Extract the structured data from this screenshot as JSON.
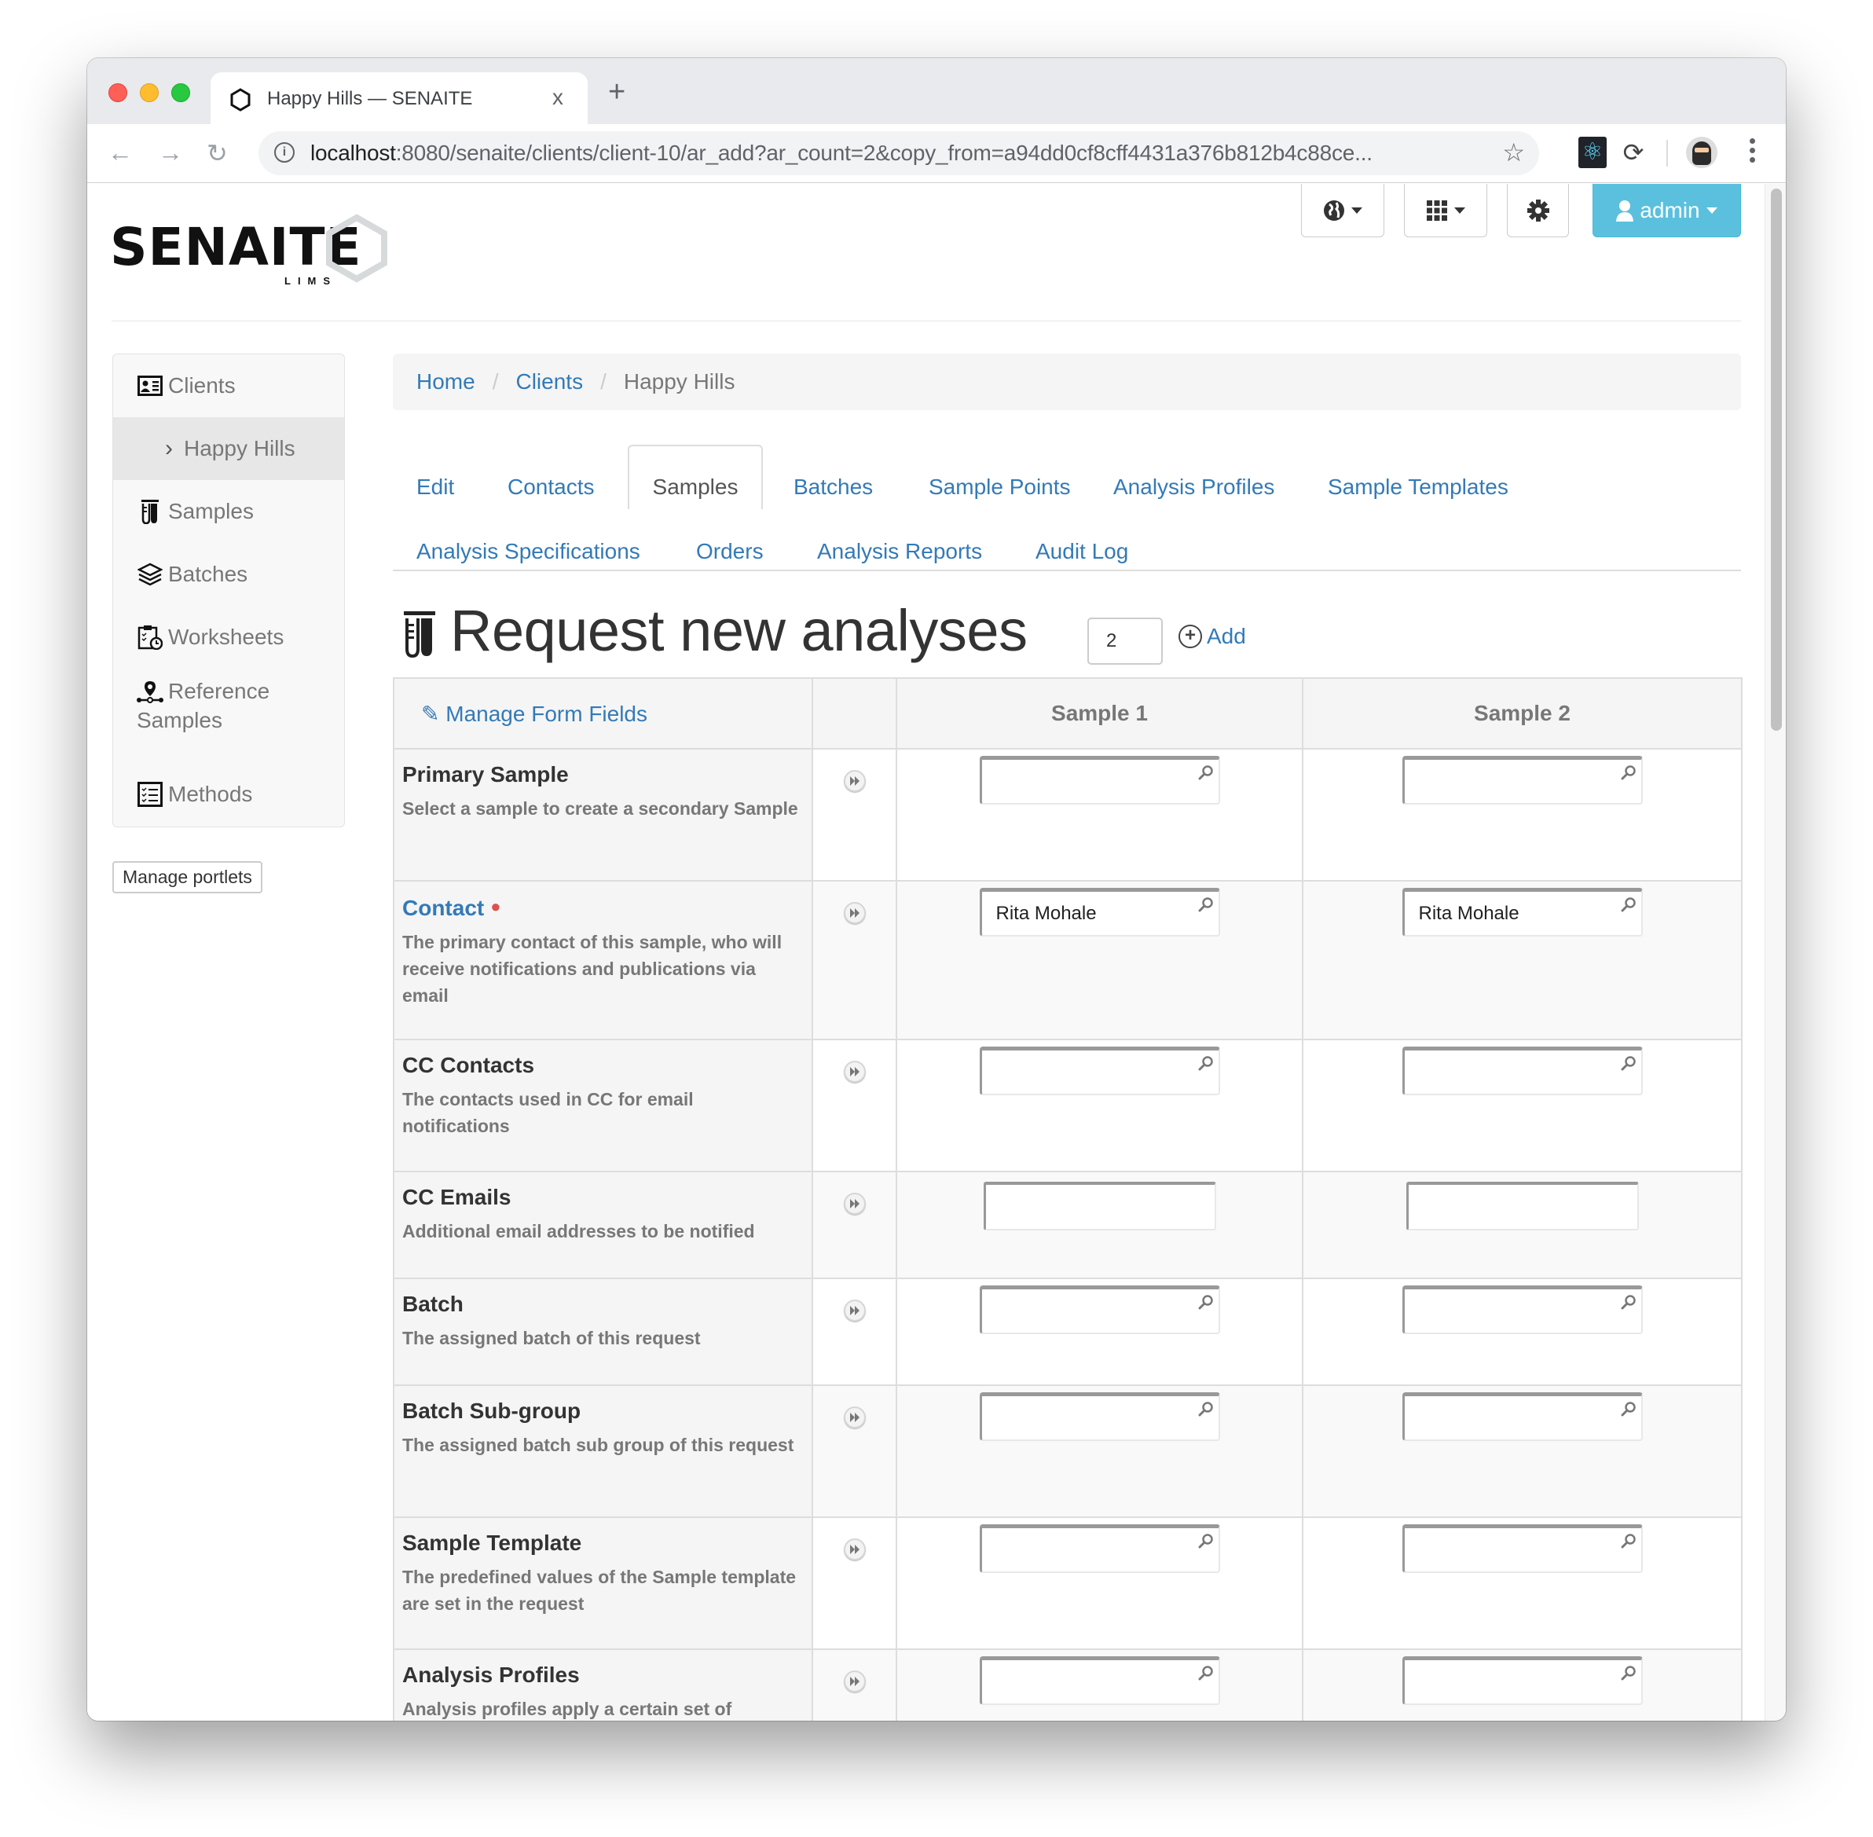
{
  "browser": {
    "tab_title": "Happy Hills — SENAITE",
    "tab_close": "x",
    "new_tab": "+",
    "url_host": "localhost",
    "url_rest": ":8080/senaite/clients/client-10/ar_add?ar_count=2&copy_from=a94dd0cf8cff4431a376b812b4c88ce..."
  },
  "header": {
    "logo_word": "SENAITE",
    "logo_sub": "LIMS",
    "user_label": "admin"
  },
  "sidebar": {
    "items": [
      {
        "label": "Clients",
        "icon": "client-card-icon"
      },
      {
        "label": "Happy Hills",
        "icon": "chevron-right-icon"
      },
      {
        "label": "Samples",
        "icon": "test-tube-icon"
      },
      {
        "label": "Batches",
        "icon": "layers-icon"
      },
      {
        "label": "Worksheets",
        "icon": "clipboard-clock-icon"
      },
      {
        "label_line1": "Reference",
        "label_line2": "Samples",
        "icon": "reference-pin-icon"
      },
      {
        "label": "Methods",
        "icon": "checklist-icon"
      }
    ],
    "manage_portlets": "Manage portlets"
  },
  "breadcrumb": {
    "items": [
      "Home",
      "Clients"
    ],
    "current": "Happy Hills",
    "separator": "/"
  },
  "tabs": [
    {
      "label": "Edit"
    },
    {
      "label": "Contacts"
    },
    {
      "label": "Samples",
      "active": true
    },
    {
      "label": "Batches"
    },
    {
      "label": "Sample Points"
    },
    {
      "label": "Analysis Profiles"
    },
    {
      "label": "Sample Templates"
    },
    {
      "label": "Analysis Specifications"
    },
    {
      "label": "Orders"
    },
    {
      "label": "Analysis Reports"
    },
    {
      "label": "Audit Log"
    }
  ],
  "page": {
    "title": "Request new analyses",
    "ar_count": "2",
    "add_label": "Add"
  },
  "table": {
    "manage_fields": "Manage Form Fields",
    "columns": [
      "Sample 1",
      "Sample 2"
    ],
    "rows": [
      {
        "name": "Primary Sample",
        "help": "Select a sample to create a secondary Sample",
        "required": false,
        "type": "reference",
        "values": [
          "",
          ""
        ]
      },
      {
        "name": "Contact",
        "help": "The primary contact of this sample, who will receive notifications and publications via email",
        "required": true,
        "type": "reference",
        "values": [
          "Rita Mohale",
          "Rita Mohale"
        ]
      },
      {
        "name": "CC Contacts",
        "help": "The contacts used in CC for email notifications",
        "required": false,
        "type": "reference",
        "values": [
          "",
          ""
        ]
      },
      {
        "name": "CC Emails",
        "help": "Additional email addresses to be notified",
        "required": false,
        "type": "text",
        "values": [
          "",
          ""
        ]
      },
      {
        "name": "Batch",
        "help": "The assigned batch of this request",
        "required": false,
        "type": "reference",
        "values": [
          "",
          ""
        ]
      },
      {
        "name": "Batch Sub-group",
        "help": "The assigned batch sub group of this request",
        "required": false,
        "type": "reference",
        "values": [
          "",
          ""
        ]
      },
      {
        "name": "Sample Template",
        "help": "The predefined values of the Sample template are set in the request",
        "required": false,
        "type": "reference",
        "values": [
          "",
          ""
        ]
      },
      {
        "name": "Analysis Profiles",
        "help": "Analysis profiles apply a certain set of",
        "required": false,
        "type": "reference",
        "values": [
          "",
          ""
        ]
      }
    ]
  },
  "colors": {
    "link": "#337ab7",
    "admin_button": "#5bc0de",
    "required_dot": "#d9534f"
  }
}
